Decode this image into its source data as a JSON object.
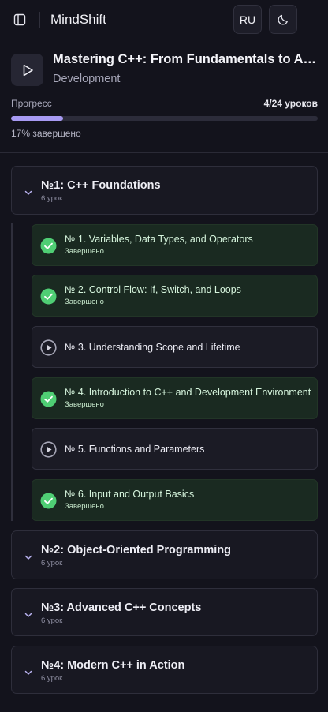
{
  "app": {
    "title": "MindShift",
    "language_button": "RU"
  },
  "course": {
    "title": "Mastering C++: From Fundamentals to Advanced Applications",
    "category": "Development",
    "progress_label": "Прогресс",
    "progress_count": "4/24 уроков",
    "progress_percent": 17,
    "progress_text": "17% завершено"
  },
  "modules": [
    {
      "title": "№1: C++ Foundations",
      "subtitle": "6 урок",
      "expanded": true,
      "lessons": [
        {
          "title": "№ 1. Variables, Data Types, and Operators",
          "status": "Завершено",
          "completed": true
        },
        {
          "title": "№ 2. Control Flow: If, Switch, and Loops",
          "status": "Завершено",
          "completed": true
        },
        {
          "title": "№ 3. Understanding Scope and Lifetime",
          "status": "",
          "completed": false
        },
        {
          "title": "№ 4. Introduction to C++ and Development Environment",
          "status": "Завершено",
          "completed": true
        },
        {
          "title": "№ 5. Functions and Parameters",
          "status": "",
          "completed": false
        },
        {
          "title": "№ 6. Input and Output Basics",
          "status": "Завершено",
          "completed": true
        }
      ]
    },
    {
      "title": "№2: Object-Oriented Programming",
      "subtitle": "6 урок",
      "expanded": false
    },
    {
      "title": "№3: Advanced C++ Concepts",
      "subtitle": "6 урок",
      "expanded": false
    },
    {
      "title": "№4: Modern C++ in Action",
      "subtitle": "6 урок",
      "expanded": false
    }
  ],
  "colors": {
    "accent": "#a79af2",
    "completed_icon": "#4fce74",
    "background": "#13131c"
  },
  "icons": {
    "sidebar_toggle": "sidebar-panel-icon",
    "theme": "moon-icon",
    "course": "play-icon",
    "lesson_done": "check-circle-icon",
    "lesson_todo": "play-circle-icon",
    "module_toggle": "chevron-down-icon"
  }
}
